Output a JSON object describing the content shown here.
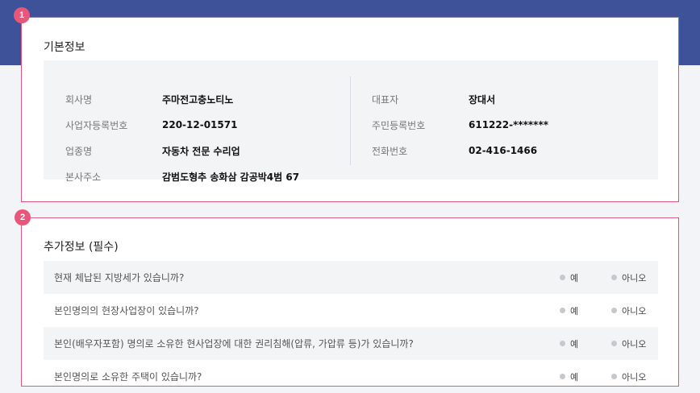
{
  "basic_info": {
    "title": "기본정보",
    "badge": "1",
    "left": [
      {
        "label": "회사명",
        "value": "주마전고충노티노"
      },
      {
        "label": "사업자등록번호",
        "value": "220-12-01571"
      },
      {
        "label": "업종명",
        "value": "자동차 전문 수리업"
      },
      {
        "label": "본사주소",
        "value": "감범도형추 송화삼 감공박4범 67"
      }
    ],
    "right": [
      {
        "label": "대표자",
        "value": "장대서"
      },
      {
        "label": "주민등록번호",
        "value": "611222-*******"
      },
      {
        "label": "전화번호",
        "value": "02-416-1466"
      }
    ]
  },
  "additional_info": {
    "title": "추가정보 (필수)",
    "badge": "2",
    "yes_label": "예",
    "no_label": "아니오",
    "questions": [
      {
        "text": "현재 체납된 지방세가 있습니까?"
      },
      {
        "text": "본인명의의 현장사업장이 있습니까?"
      },
      {
        "text": "본인(배우자포함) 명의로 소유한 현사업장에 대한 권리침해(압류, 가압류 등)가 있습니까?"
      },
      {
        "text": "본인명의로 소유한 주택이 있습니까?"
      }
    ]
  },
  "colors": {
    "header_band": "#3d5298",
    "badge": "#e8577a",
    "card_border": "#e05a78"
  }
}
